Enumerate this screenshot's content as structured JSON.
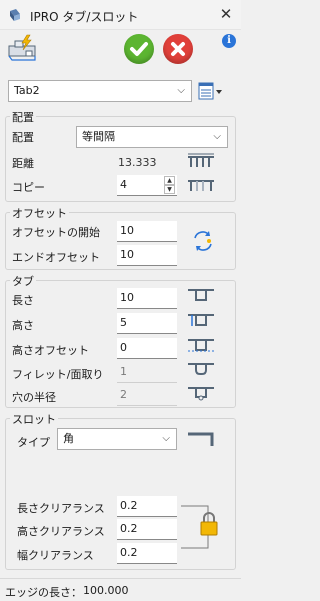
{
  "window": {
    "title": "IPRO タブ/スロット",
    "close_glyph": "✕"
  },
  "toolbar": {
    "tab_select_value": "Tab2",
    "info_glyph": "i"
  },
  "placement": {
    "legend": "配置",
    "placement_label": "配置",
    "placement_value": "等間隔",
    "distance_label": "距離",
    "distance_value": "13.333",
    "copy_label": "コピー",
    "copy_value": "4"
  },
  "offset": {
    "legend": "オフセット",
    "start_label": "オフセットの開始",
    "start_value": "10",
    "end_label": "エンドオフセット",
    "end_value": "10"
  },
  "tab": {
    "legend": "タブ",
    "length_label": "長さ",
    "length_value": "10",
    "height_label": "高さ",
    "height_value": "5",
    "height_offset_label": "高さオフセット",
    "height_offset_value": "0",
    "fillet_label": "フィレット/面取り",
    "fillet_value": "1",
    "hole_radius_label": "穴の半径",
    "hole_radius_value": "2"
  },
  "slot": {
    "legend": "スロット",
    "type_label": "タイプ",
    "type_value": "角",
    "length_clearance_label": "長さクリアランス",
    "length_clearance_value": "0.2",
    "height_clearance_label": "高さクリアランス",
    "height_clearance_value": "0.2",
    "width_clearance_label": "幅クリアランス",
    "width_clearance_value": "0.2"
  },
  "status": {
    "label": "エッジの長さ：",
    "value": "100.000"
  },
  "colors": {
    "ok_green": "#5cb531",
    "cancel_red": "#e0403a",
    "info_blue": "#2a74d8",
    "icon_slate": "#556677"
  }
}
